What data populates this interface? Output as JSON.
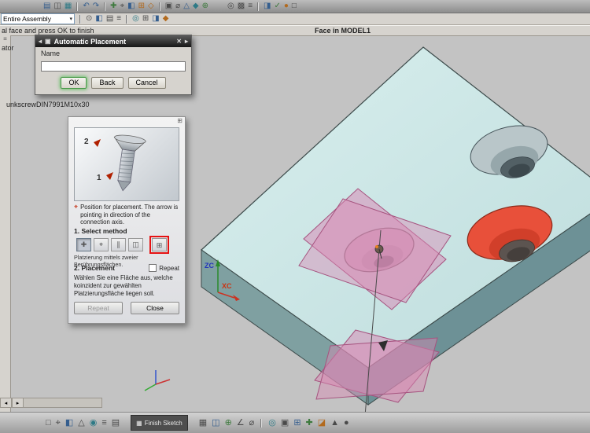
{
  "colors": {
    "block_top": "#cfe9e9",
    "block_left": "#7fa0a1",
    "block_right": "#6d9196",
    "selected_hole": "#e8503a",
    "plane_pink": "#d989b4",
    "annotation_red": "#e51212",
    "ok_glow": "#55aa55"
  },
  "icons": {
    "caret_down": "▾",
    "close": "✕",
    "back_arrow": "◂",
    "forward_arrow": "▸",
    "dialog_icon": "▣",
    "grip": "⊞",
    "scroll_left": "◂",
    "scroll_right": "▸",
    "finish_sketch_icon": "▦",
    "info_screw_icon": "⌖",
    "resource_bar": "≡"
  },
  "toolbars": {
    "top": [
      {
        "name": "open-part-icon",
        "glyph": "▤"
      },
      {
        "name": "display-mode-icon",
        "glyph": "◫"
      },
      {
        "name": "layers-icon",
        "glyph": "▦"
      },
      {
        "name": "undo-icon",
        "glyph": "↶"
      },
      {
        "name": "redo-icon",
        "glyph": "↷"
      },
      {
        "name": "add-component-icon",
        "glyph": "✚"
      },
      {
        "name": "point-tool-icon",
        "glyph": "⌖"
      },
      {
        "name": "datum-plane-icon",
        "glyph": "◧"
      },
      {
        "name": "pattern-feature-icon",
        "glyph": "⊞"
      },
      {
        "name": "sketch-icon",
        "glyph": "◇"
      },
      {
        "name": "hole-feature-icon",
        "glyph": "▣"
      },
      {
        "name": "diameter-dimension-icon",
        "glyph": "⌀"
      },
      {
        "name": "draft-icon",
        "glyph": "△"
      },
      {
        "name": "feature-icon",
        "glyph": "◆"
      },
      {
        "name": "unite-icon",
        "glyph": "⊕"
      },
      {
        "name": "orient-view-icon",
        "glyph": "◎"
      },
      {
        "name": "shaded-view-icon",
        "glyph": "▩"
      },
      {
        "name": "menu-list-icon",
        "glyph": "≡"
      },
      {
        "name": "section-view-icon",
        "glyph": "◨"
      },
      {
        "name": "apply-icon",
        "glyph": "✓"
      },
      {
        "name": "render-style-icon",
        "glyph": "●"
      },
      {
        "name": "window-icon",
        "glyph": "□"
      }
    ],
    "second": {
      "assembly_dropdown": "Entire Assembly",
      "icons": [
        {
          "name": "selection-filter-icon",
          "glyph": "⊙"
        },
        {
          "name": "show-hide-icon",
          "glyph": "◧"
        },
        {
          "name": "layer-settings-icon",
          "glyph": "▤"
        },
        {
          "name": "list-icon",
          "glyph": "≡"
        },
        {
          "name": "snap-point-icon",
          "glyph": "◎"
        },
        {
          "name": "grid-icon",
          "glyph": "⊞"
        },
        {
          "name": "half-section-icon",
          "glyph": "◨"
        },
        {
          "name": "highlight-icon",
          "glyph": "◆"
        }
      ]
    },
    "bottom": {
      "left_icons": [
        {
          "name": "select-filter-icon",
          "glyph": "□"
        },
        {
          "name": "snap-icon",
          "glyph": "⌖"
        },
        {
          "name": "plane-tool-icon",
          "glyph": "◧"
        },
        {
          "name": "triangle-tool-icon",
          "glyph": "△"
        },
        {
          "name": "target-icon",
          "glyph": "◉"
        },
        {
          "name": "menu-icon",
          "glyph": "≡"
        },
        {
          "name": "table-icon",
          "glyph": "▤"
        }
      ],
      "finish_sketch_label": "Finish Sketch",
      "right_icons": [
        {
          "name": "shade-icon",
          "glyph": "▦"
        },
        {
          "name": "wireframe-icon",
          "glyph": "◫"
        },
        {
          "name": "boolean-icon",
          "glyph": "⊕"
        },
        {
          "name": "angle-icon",
          "glyph": "∠"
        },
        {
          "name": "diameter-icon",
          "glyph": "⌀"
        },
        {
          "name": "orient-icon",
          "glyph": "◎"
        },
        {
          "name": "hole-icon",
          "glyph": "▣"
        },
        {
          "name": "grid-icon",
          "glyph": "⊞"
        },
        {
          "name": "add-icon",
          "glyph": "✚"
        },
        {
          "name": "corner-icon",
          "glyph": "◪"
        },
        {
          "name": "up-icon",
          "glyph": "▲"
        },
        {
          "name": "dot-icon",
          "glyph": "●"
        }
      ]
    }
  },
  "prompt_bar": {
    "message": "al face and press OK to finish",
    "selection_info": "Face in MODEL1"
  },
  "auto_placement_dialog": {
    "title": "Automatic Placement",
    "name_label": "Name",
    "name_value": "",
    "ok": "OK",
    "back": "Back",
    "cancel": "Cancel"
  },
  "resource_labels": {
    "panel_title_partial": "ator",
    "component_name_partial": "unkscrewDIN7991M10x30"
  },
  "placement_panel": {
    "info_text": "Position for placement. The arrow is pointing in direction of the connection axis.",
    "step1_title": "1. Select method",
    "method_caption": "Platzierung mittels zweier Berührungsflächen.",
    "step2_title": "2. Placement",
    "repeat_label": "Repeat",
    "step2_text": "Wählen Sie eine Fläche aus, welche koinzident zur gewählten Platzierungsfläche liegen soll.",
    "repeat_button": "Repeat",
    "close_button": "Close",
    "preview": {
      "label_1": "1",
      "label_2": "2"
    },
    "methods": [
      {
        "name": "place-by-point-icon",
        "glyph": "✚"
      },
      {
        "name": "place-by-csys-icon",
        "glyph": "⌖"
      },
      {
        "name": "place-parallel-icon",
        "glyph": "∥"
      },
      {
        "name": "place-by-face-icon",
        "glyph": "◫"
      },
      {
        "name": "place-two-touch-faces-icon",
        "glyph": "⊞"
      }
    ]
  },
  "viewport": {
    "axis_zc": "ZC",
    "axis_xc": "XC"
  }
}
